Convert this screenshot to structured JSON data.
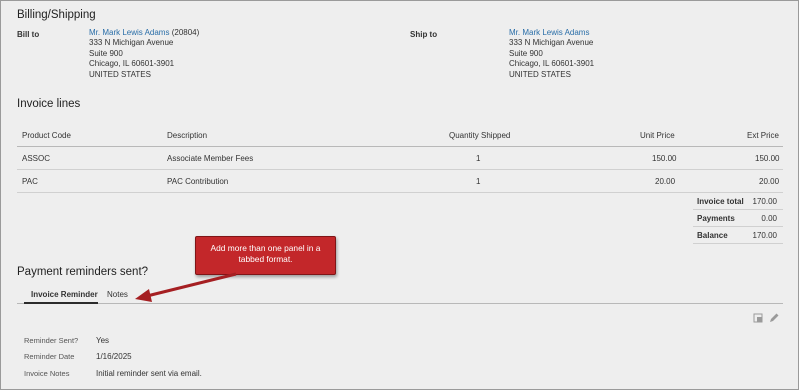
{
  "billing": {
    "title": "Billing/Shipping",
    "bill_to_label": "Bill to",
    "bill_to": {
      "name": "Mr. Mark Lewis Adams",
      "id": "(20804)",
      "line1": "333 N Michigan Avenue",
      "line2": "Suite 900",
      "line3": "Chicago, IL 60601-3901",
      "line4": "UNITED STATES"
    },
    "ship_to_label": "Ship to",
    "ship_to": {
      "name": "Mr. Mark Lewis Adams",
      "line1": "333 N Michigan Avenue",
      "line2": "Suite 900",
      "line3": "Chicago, IL 60601-3901",
      "line4": "UNITED STATES"
    }
  },
  "invoice": {
    "title": "Invoice lines",
    "columns": [
      "Product Code",
      "Description",
      "Quantity Shipped",
      "Unit Price",
      "Ext Price"
    ],
    "rows": [
      {
        "code": "ASSOC",
        "description": "Associate Member Fees",
        "qty": "1",
        "unit": "150.00",
        "ext": "150.00"
      },
      {
        "code": "PAC",
        "description": "PAC Contribution",
        "qty": "1",
        "unit": "20.00",
        "ext": "20.00"
      }
    ],
    "totals": [
      {
        "label": "Invoice total",
        "value": "170.00"
      },
      {
        "label": "Payments",
        "value": "0.00"
      },
      {
        "label": "Balance",
        "value": "170.00"
      }
    ]
  },
  "reminders": {
    "title": "Payment reminders sent?",
    "tabs": [
      "Invoice Reminder",
      "Notes"
    ],
    "callout": "Add more than one panel in a tabbed format.",
    "fields": [
      {
        "label": "Reminder Sent?",
        "value": "Yes"
      },
      {
        "label": "Reminder Date",
        "value": "1/16/2025"
      },
      {
        "label": "Invoice Notes",
        "value": "Initial reminder sent via email."
      }
    ]
  },
  "icons": {
    "copy": "copy-icon",
    "edit": "pencil-icon"
  },
  "colors": {
    "link": "#2a6ea8",
    "callout": "#c3272a",
    "arrow": "#a51f22"
  }
}
